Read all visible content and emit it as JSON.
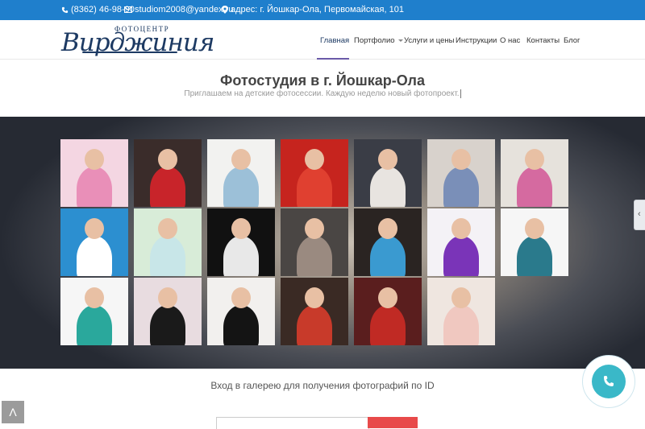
{
  "topbar": {
    "phone": "(8362) 46-98-90",
    "email": "studiom2008@yandex.ru",
    "address": "адрес: г. Йошкар-Ола, Первомайская, 101"
  },
  "logo": {
    "small": "ФОТОЦЕНТР",
    "big": "Вирджиния"
  },
  "nav": [
    {
      "label": "Главная",
      "active": true
    },
    {
      "label": "Портфолио",
      "dropdown": true
    },
    {
      "label": "Услуги и цены"
    },
    {
      "label": "Инструкции"
    },
    {
      "label": "О нас"
    },
    {
      "label": "Контакты"
    },
    {
      "label": "Блог"
    }
  ],
  "hero": {
    "title": "Фотостудия в г. Йошкар-Ола",
    "subtitle": "Приглашаем на детские фотосессии. Каждую неделю новый фотопроект."
  },
  "gallery": {
    "photos": [
      {
        "bg": "#f4d6e2",
        "fig": "#e98fb8"
      },
      {
        "bg": "#3a2c2a",
        "fig": "#c8242a"
      },
      {
        "bg": "#f2f2f0",
        "fig": "#9cc0d8"
      },
      {
        "bg": "#c6241e",
        "fig": "#e04030"
      },
      {
        "bg": "#3a3d46",
        "fig": "#e8e4e0"
      },
      {
        "bg": "#d8d2cc",
        "fig": "#7a8fb8"
      },
      {
        "bg": "#e6e2dc",
        "fig": "#d56aa0"
      },
      {
        "bg": "#2c8fd0",
        "fig": "#ffffff"
      },
      {
        "bg": "#d8ecd8",
        "fig": "#c8e6e8"
      },
      {
        "bg": "#111111",
        "fig": "#e8e8e8"
      },
      {
        "bg": "#4a4644",
        "fig": "#9a8a80"
      },
      {
        "bg": "#2a2422",
        "fig": "#3a9ad0"
      },
      {
        "bg": "#f4f2f6",
        "fig": "#7a34b8"
      },
      {
        "bg": "#f6f6f6",
        "fig": "#2a7a8c"
      },
      {
        "bg": "#f6f6f6",
        "fig": "#2aa89c"
      },
      {
        "bg": "#e8dce0",
        "fig": "#1a1a1a"
      },
      {
        "bg": "#f2f0ee",
        "fig": "#141414"
      },
      {
        "bg": "#3a2a24",
        "fig": "#c83a2a"
      },
      {
        "bg": "#5a1e1e",
        "fig": "#c02a24"
      },
      {
        "bg": "#efe6e0",
        "fig": "#f0c8c0"
      }
    ]
  },
  "gallery_login": {
    "label": "Вход в галерею для получения фотографий по ID"
  },
  "colors": {
    "topbar": "#1f7fcc",
    "accent": "#3ab8c8",
    "button": "#e84a4a"
  }
}
